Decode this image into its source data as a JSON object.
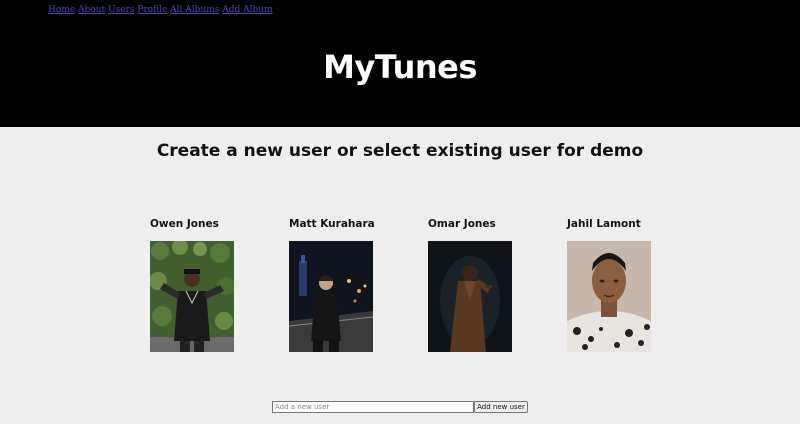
{
  "nav": {
    "links": [
      "Home",
      "About",
      "Users",
      "Profile",
      "All Albums",
      "Add Album"
    ]
  },
  "brand": {
    "title": "MyTunes"
  },
  "page": {
    "subtitle": "Create a new user or select existing user for demo"
  },
  "users": [
    {
      "name": "Owen Jones"
    },
    {
      "name": "Matt Kurahara"
    },
    {
      "name": "Omar Jones"
    },
    {
      "name": "Jahil Lamont"
    }
  ],
  "add_user": {
    "placeholder": "Add a new user",
    "button_label": "Add new user"
  },
  "colors": {
    "header_bg": "#000000",
    "page_bg": "#eeeeee",
    "link": "#5b3cc4"
  }
}
